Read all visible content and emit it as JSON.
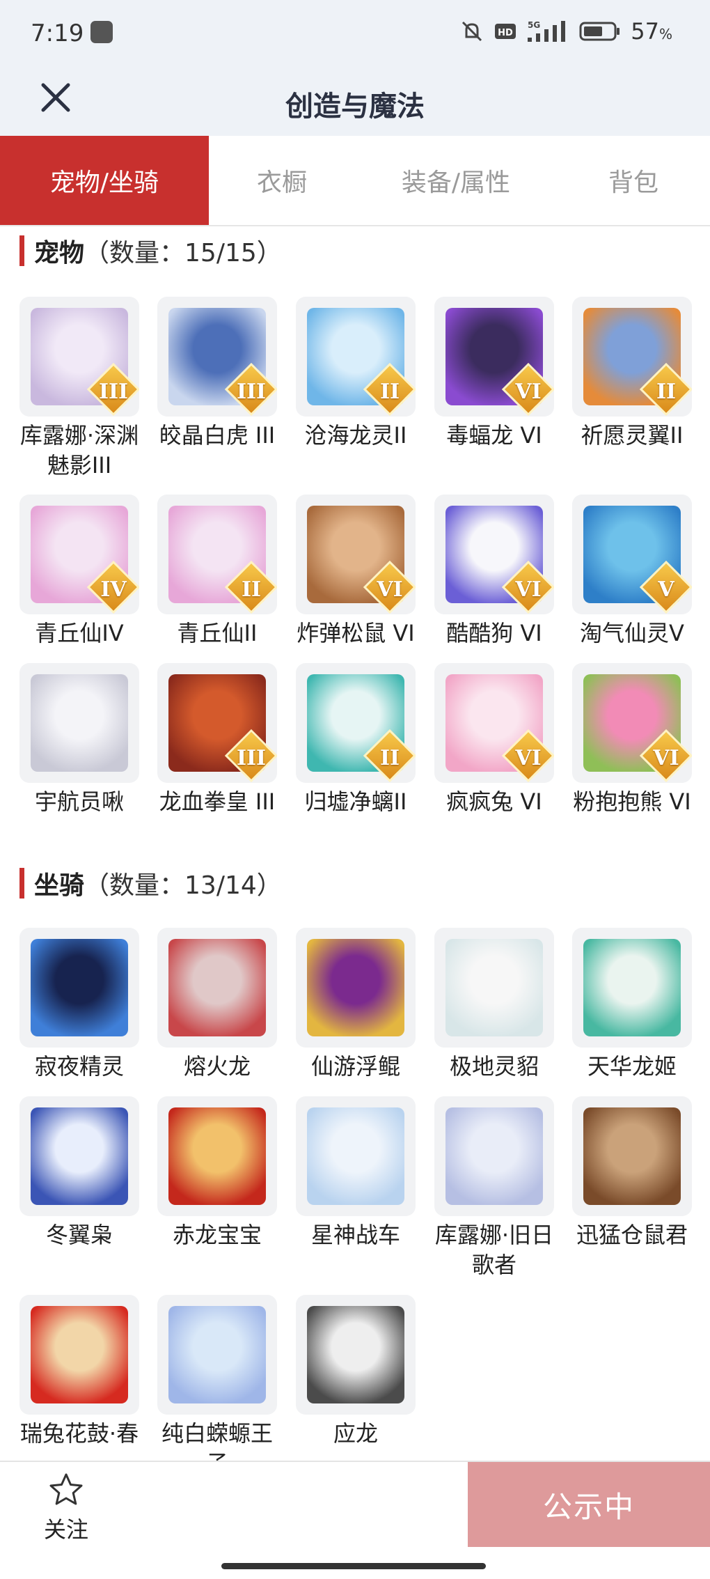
{
  "status_bar": {
    "time": "7:19",
    "battery": "57",
    "battery_unit": "%"
  },
  "header": {
    "title": "创造与魔法"
  },
  "tabs": [
    {
      "label": "宠物/坐骑"
    },
    {
      "label": "衣橱"
    },
    {
      "label": "装备/属性"
    },
    {
      "label": "背包"
    }
  ],
  "pets": {
    "name": "宠物",
    "count": "（数量：15/15）",
    "items": [
      {
        "name": "库露娜·深渊魅影III",
        "badge": "III",
        "colors": [
          "#f1e9f7",
          "#c9b8de"
        ]
      },
      {
        "name": "皎晶白虎 III",
        "badge": "III",
        "colors": [
          "#4d6fb8",
          "#c9d6ee"
        ]
      },
      {
        "name": "沧海龙灵II",
        "badge": "II",
        "colors": [
          "#d9eefb",
          "#6fb6e8"
        ]
      },
      {
        "name": "毒蝠龙 VI",
        "badge": "VI",
        "colors": [
          "#3b2c5e",
          "#8a4bd0"
        ]
      },
      {
        "name": "祈愿灵翼II",
        "badge": "II",
        "colors": [
          "#7fa0d8",
          "#e58b3a"
        ]
      },
      {
        "name": "青丘仙IV",
        "badge": "IV",
        "colors": [
          "#f4e4f3",
          "#e7a7d8"
        ]
      },
      {
        "name": "青丘仙II",
        "badge": "II",
        "colors": [
          "#f4e4f3",
          "#e7a7d8"
        ]
      },
      {
        "name": "炸弹松鼠 VI",
        "badge": "VI",
        "colors": [
          "#e2b48a",
          "#a86a3c"
        ]
      },
      {
        "name": "酷酷狗 VI",
        "badge": "VI",
        "colors": [
          "#f7f7fb",
          "#6b5fd6"
        ]
      },
      {
        "name": "淘气仙灵V",
        "badge": "V",
        "colors": [
          "#6ec1ea",
          "#2e7fc8"
        ]
      },
      {
        "name": "宇航员啾",
        "badge": "",
        "colors": [
          "#f4f4f8",
          "#c9c9d6"
        ]
      },
      {
        "name": "龙血拳皇 III",
        "badge": "III",
        "colors": [
          "#d45a2c",
          "#8b2a1c"
        ]
      },
      {
        "name": "归墟净螭II",
        "badge": "II",
        "colors": [
          "#e6f5f4",
          "#3fb7b0"
        ]
      },
      {
        "name": "疯疯兔 VI",
        "badge": "VI",
        "colors": [
          "#fbe6ef",
          "#f2a6c7"
        ]
      },
      {
        "name": "粉抱抱熊 VI",
        "badge": "VI",
        "colors": [
          "#f28bb6",
          "#8fbf57"
        ]
      }
    ]
  },
  "mounts": {
    "name": "坐骑",
    "count": "（数量：13/14）",
    "items": [
      {
        "name": "寂夜精灵",
        "colors": [
          "#17234f",
          "#3f7fd8"
        ]
      },
      {
        "name": "熔火龙",
        "colors": [
          "#e0c8c8",
          "#c8474a"
        ]
      },
      {
        "name": "仙游浮鲲",
        "colors": [
          "#7b2a8e",
          "#e3b640"
        ]
      },
      {
        "name": "极地灵貂",
        "colors": [
          "#f7f7f7",
          "#d8e6e8"
        ]
      },
      {
        "name": "天华龙姬",
        "colors": [
          "#eaf4ef",
          "#48b8a1"
        ]
      },
      {
        "name": "冬翼枭",
        "colors": [
          "#e8eefc",
          "#3b55b5"
        ]
      },
      {
        "name": "赤龙宝宝",
        "colors": [
          "#f2c16b",
          "#c4281c"
        ]
      },
      {
        "name": "星神战车",
        "colors": [
          "#eef4fb",
          "#b9d3ef"
        ]
      },
      {
        "name": "库露娜·旧日歌者",
        "colors": [
          "#e9edf8",
          "#b6bfe3"
        ]
      },
      {
        "name": "迅猛仓鼠君",
        "colors": [
          "#caa27a",
          "#7a4b2a"
        ]
      },
      {
        "name": "瑞兔花鼓·春",
        "colors": [
          "#f2d6a8",
          "#d62a20"
        ]
      },
      {
        "name": "纯白蝾螈王子",
        "colors": [
          "#d9e8f8",
          "#9fb6e8"
        ]
      },
      {
        "name": "应龙",
        "colors": [
          "#eeeeee",
          "#4b4b4b"
        ]
      }
    ]
  },
  "bottom_bar": {
    "follow_label": "关注",
    "notice_label": "公示中"
  }
}
